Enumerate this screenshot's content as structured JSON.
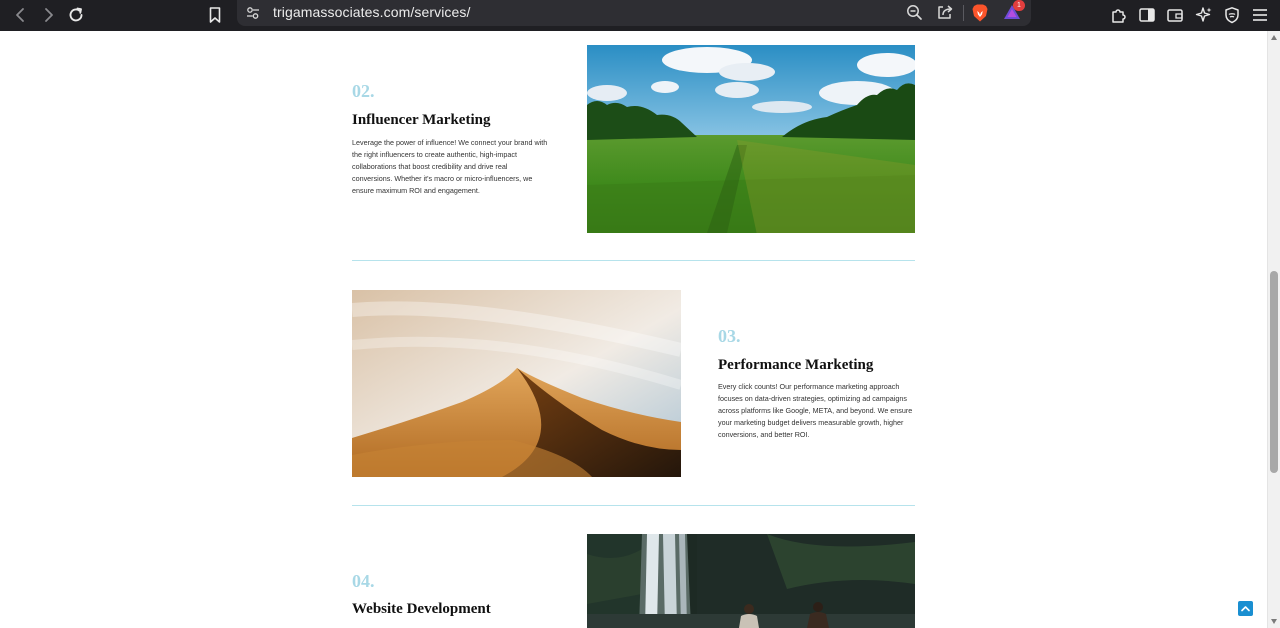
{
  "browser": {
    "url": "trigamassociates.com/services/",
    "notification_count": "1"
  },
  "services": [
    {
      "number": "02.",
      "title": "Influencer Marketing",
      "description": "Leverage the power of influence! We connect your brand with the right influencers to create authentic, high-impact collaborations that boost credibility and drive real conversions. Whether it's macro or micro-influencers, we ensure maximum ROI and engagement."
    },
    {
      "number": "03.",
      "title": "Performance Marketing",
      "description": "Every click counts! Our performance marketing approach focuses on data-driven strategies, optimizing ad campaigns across platforms like Google, META, and beyond. We ensure your marketing budget delivers measurable growth, higher conversions, and better ROI."
    },
    {
      "number": "04.",
      "title": "Website Development"
    }
  ],
  "colors": {
    "accent_number": "#a8d8e6",
    "divider": "#b6e3ec",
    "back_to_top": "#1a8fd1"
  },
  "icons": {
    "back": "chevron-left-icon",
    "forward": "chevron-right-icon",
    "reload": "reload-icon",
    "bookmark": "bookmark-icon",
    "site_settings": "tune-icon",
    "zoom": "zoom-out-icon",
    "share": "share-icon",
    "brave_shields": "brave-lion-icon",
    "brave_rewards": "rewards-triangle-icon",
    "extensions": "puzzle-icon",
    "sidebar": "sidebar-icon",
    "wallet": "wallet-icon",
    "leo": "sparkle-icon",
    "vpn": "shield-icon",
    "menu": "hamburger-menu-icon",
    "back_to_top": "arrow-up-icon"
  }
}
